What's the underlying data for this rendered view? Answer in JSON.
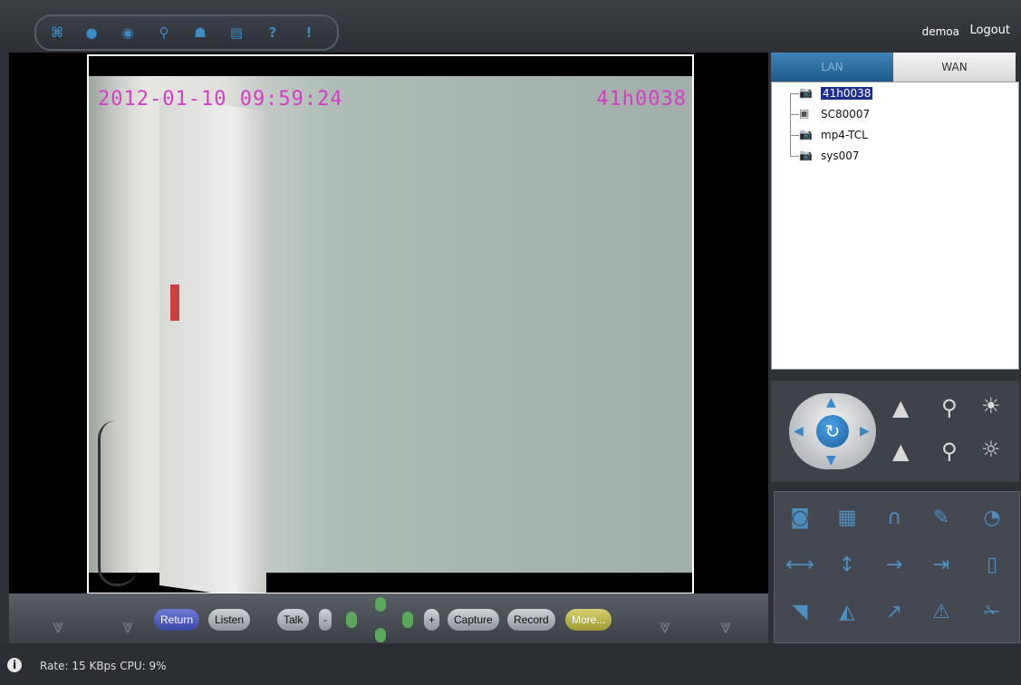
{
  "toolbar": {
    "icons": [
      "fullscreen-icon",
      "record-icon",
      "capture-icon",
      "search-icon",
      "user-icon",
      "save-icon",
      "help-icon",
      "info-icon"
    ],
    "glyphs": [
      "⌘",
      "●",
      "◉",
      "⚲",
      "☗",
      "▤",
      "?",
      "!"
    ]
  },
  "header": {
    "username": "demoa",
    "logout_label": "Logout"
  },
  "video": {
    "osd_time": "2012-01-10 09:59:24",
    "osd_camera": "41h0038"
  },
  "controls": {
    "return_label": "Return",
    "listen_label": "Listen",
    "talk_label": "Talk",
    "minus_label": "-",
    "plus_label": "+",
    "capture_label": "Capture",
    "record_label": "Record",
    "more_label": "More..."
  },
  "status": {
    "text": "Rate: 15 KBps  CPU:  9%"
  },
  "tabs": {
    "lan": "LAN",
    "wan": "WAN"
  },
  "devices": [
    {
      "label": "41h0038",
      "icon": "camera-icon",
      "selected": true
    },
    {
      "label": "SC80007",
      "icon": "3g-camera-icon",
      "selected": false
    },
    {
      "label": "mp4-TCL",
      "icon": "camera-icon",
      "selected": false
    },
    {
      "label": "sys007",
      "icon": "camera-icon",
      "selected": false
    }
  ],
  "colors": {
    "osd": "#d63dc4",
    "accent": "#3a8bc6",
    "selection": "#1e2f8a"
  }
}
